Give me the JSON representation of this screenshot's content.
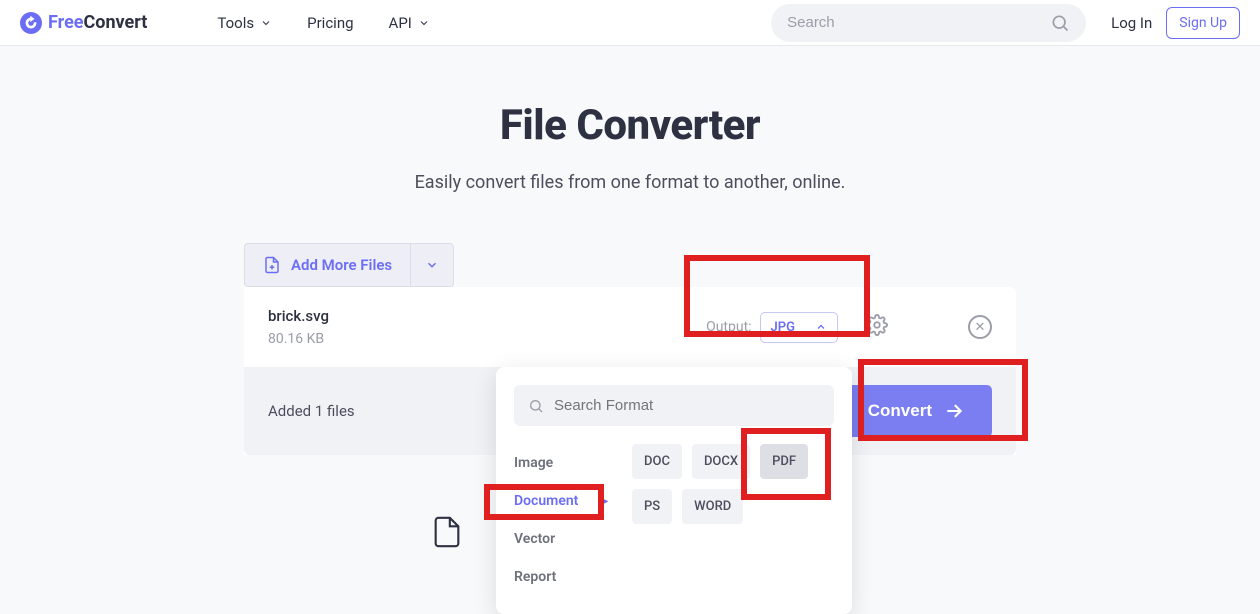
{
  "header": {
    "logo": {
      "free": "Free",
      "convert": "Convert"
    },
    "nav": {
      "tools": "Tools",
      "pricing": "Pricing",
      "api": "API"
    },
    "search_placeholder": "Search",
    "login": "Log In",
    "signup": "Sign Up"
  },
  "main": {
    "title": "File Converter",
    "subtitle": "Easily convert files from one format to another, online."
  },
  "panel": {
    "add_more": "Add More Files",
    "file": {
      "name": "brick.svg",
      "size": "80.16 KB"
    },
    "output_label": "Output:",
    "output_value": "JPG",
    "status": "Added 1 files",
    "convert": "Convert"
  },
  "dropdown": {
    "search_placeholder": "Search Format",
    "categories": {
      "image": "Image",
      "document": "Document",
      "vector": "Vector",
      "report": "Report"
    },
    "formats": {
      "doc": "DOC",
      "docx": "DOCX",
      "pdf": "PDF",
      "ps": "PS",
      "word": "WORD"
    }
  }
}
